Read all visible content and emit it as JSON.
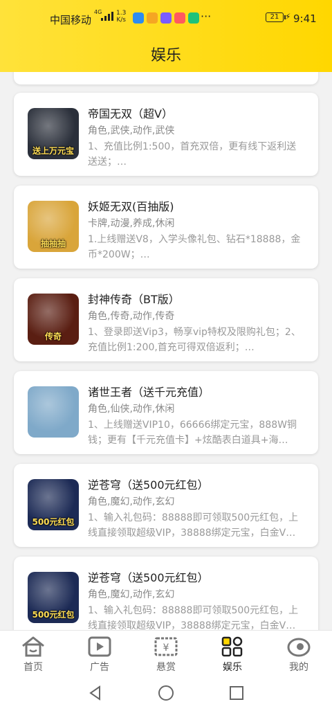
{
  "status_bar": {
    "carrier": "中国移动",
    "signal_tag": "4G",
    "speed_value": "1.3",
    "speed_unit": "K/s",
    "more": "···",
    "battery": "21",
    "time": "9:41"
  },
  "header": {
    "title": "娱乐"
  },
  "games": [
    {
      "title": "帝国无双（超V）",
      "tags": "角色,武侠,动作,武侠",
      "desc": "1、充值比例1:500，首充双倍，更有线下返利送送送；…",
      "thumb_text": "送上万元宝",
      "thumb_color": "#2a2f3a"
    },
    {
      "title": "妖姬无双(百抽版)",
      "tags": "卡牌,动漫,养成,休闲",
      "desc": "1.上线赠送V8，入学头像礼包、钻石*18888，金币*200W；…",
      "thumb_text": "抽抽抽",
      "thumb_color": "#d9a53a"
    },
    {
      "title": "封神传奇（BT版）",
      "tags": "角色,传奇,动作,传奇",
      "desc": "1、登录即送Vip3，畅享vip特权及限购礼包；2、充值比例1:200,首充可得双倍返利；…",
      "thumb_text": "传奇",
      "thumb_color": "#5a1e12"
    },
    {
      "title": "诸世王者（送千元充值）",
      "tags": "角色,仙侠,动作,休闲",
      "desc": "1、上线赠送VIP10，66666绑定元宝，888W铜钱；更有【千元充值卡】+炫酷表白道具+海…",
      "thumb_text": "",
      "thumb_color": "#7fa9c9"
    },
    {
      "title": "逆苍穹（送500元红包）",
      "tags": "角色,魔幻,动作,玄幻",
      "desc": "1、输入礼包码：88888即可领取500元红包，上线直接领取超级VIP，38888绑定元宝，白金V…",
      "thumb_text": "500元红包",
      "thumb_color": "#1c2a55"
    },
    {
      "title": "逆苍穹（送500元红包）",
      "tags": "角色,魔幻,动作,玄幻",
      "desc": "1、输入礼包码：88888即可领取500元红包，上线直接领取超级VIP，38888绑定元宝，白金V…",
      "thumb_text": "500元红包",
      "thumb_color": "#1c2a55"
    }
  ],
  "tabs": [
    {
      "label": "首页",
      "icon": "home-icon",
      "active": false
    },
    {
      "label": "广告",
      "icon": "video-play-icon",
      "active": false
    },
    {
      "label": "悬赏",
      "icon": "reward-ticket-icon",
      "active": false
    },
    {
      "label": "娱乐",
      "icon": "grid-apps-icon",
      "active": true
    },
    {
      "label": "我的",
      "icon": "profile-icon",
      "active": false
    }
  ],
  "colors": {
    "header_yellow": "#ffd700",
    "accent": "#ffd700"
  }
}
